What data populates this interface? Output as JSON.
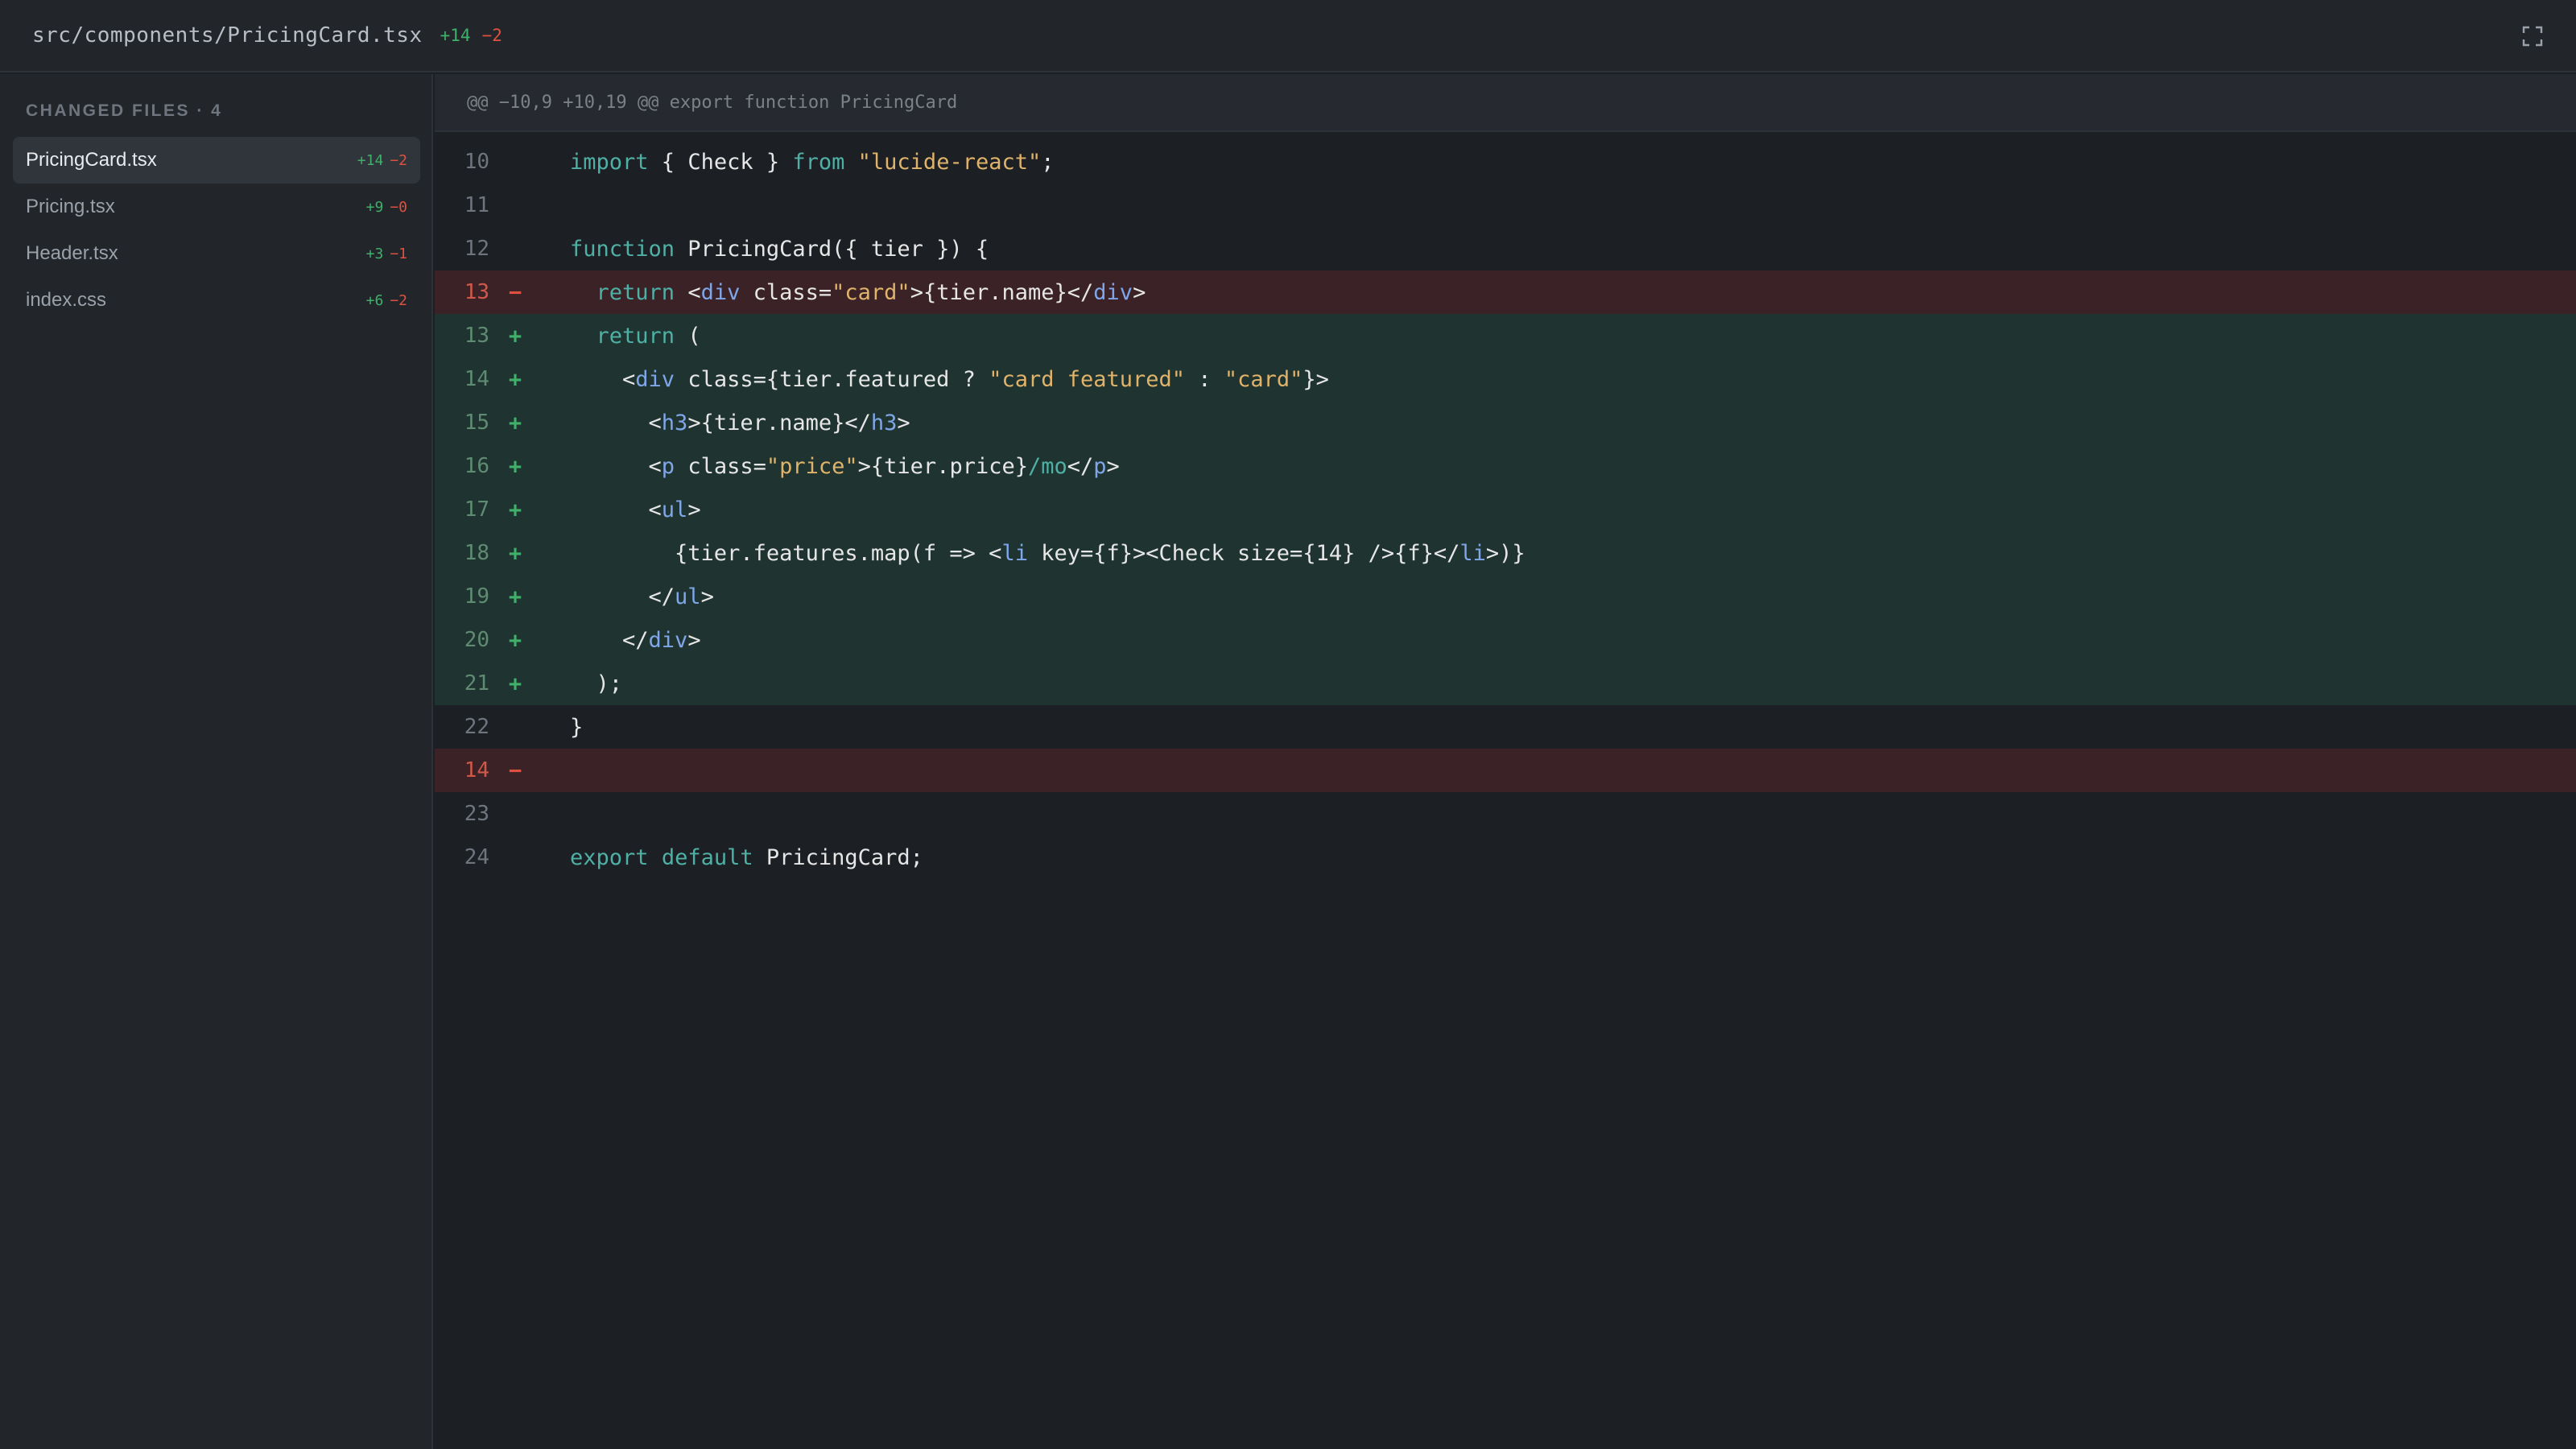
{
  "header": {
    "file_path": "src/components/PricingCard.tsx",
    "additions": "+14",
    "deletions": "−2",
    "expand_icon": "expand-icon"
  },
  "sidebar": {
    "title": "CHANGED FILES · 4",
    "files": [
      {
        "name": "PricingCard.tsx",
        "additions": "+14",
        "deletions": "−2",
        "active": true
      },
      {
        "name": "Pricing.tsx",
        "additions": "+9",
        "deletions": "−0",
        "active": false
      },
      {
        "name": "Header.tsx",
        "additions": "+3",
        "deletions": "−1",
        "active": false
      },
      {
        "name": "index.css",
        "additions": "+6",
        "deletions": "−2",
        "active": false
      }
    ]
  },
  "diff": {
    "hunk_header": "@@ −10,9 +10,19 @@ export function PricingCard",
    "lines": [
      {
        "num": "10",
        "type": "context",
        "marker": "",
        "tokens": [
          {
            "t": "import",
            "c": "kw"
          },
          {
            "t": " { Check } ",
            "c": "txt"
          },
          {
            "t": "from",
            "c": "kw"
          },
          {
            "t": " ",
            "c": "txt"
          },
          {
            "t": "\"lucide-react\"",
            "c": "str"
          },
          {
            "t": ";",
            "c": "txt"
          }
        ]
      },
      {
        "num": "11",
        "type": "context",
        "marker": "",
        "tokens": []
      },
      {
        "num": "12",
        "type": "context",
        "marker": "",
        "tokens": [
          {
            "t": "function",
            "c": "kw"
          },
          {
            "t": " PricingCard({ tier }) {",
            "c": "txt"
          }
        ]
      },
      {
        "num": "13",
        "type": "removed",
        "marker": "−",
        "tokens": [
          {
            "t": "  ",
            "c": "txt"
          },
          {
            "t": "return",
            "c": "kw"
          },
          {
            "t": " <",
            "c": "txt"
          },
          {
            "t": "div",
            "c": "tag"
          },
          {
            "t": " class=",
            "c": "txt"
          },
          {
            "t": "\"card\"",
            "c": "str"
          },
          {
            "t": ">{tier.name}</",
            "c": "txt"
          },
          {
            "t": "div",
            "c": "tag"
          },
          {
            "t": ">",
            "c": "txt"
          }
        ]
      },
      {
        "num": "13",
        "type": "added",
        "marker": "+",
        "tokens": [
          {
            "t": "  ",
            "c": "txt"
          },
          {
            "t": "return",
            "c": "kw"
          },
          {
            "t": " (",
            "c": "txt"
          }
        ]
      },
      {
        "num": "14",
        "type": "added",
        "marker": "+",
        "tokens": [
          {
            "t": "    <",
            "c": "txt"
          },
          {
            "t": "div",
            "c": "tag"
          },
          {
            "t": " class={tier.featured ? ",
            "c": "txt"
          },
          {
            "t": "\"card featured\"",
            "c": "str"
          },
          {
            "t": " : ",
            "c": "txt"
          },
          {
            "t": "\"card\"",
            "c": "str"
          },
          {
            "t": "}>",
            "c": "txt"
          }
        ]
      },
      {
        "num": "15",
        "type": "added",
        "marker": "+",
        "tokens": [
          {
            "t": "      <",
            "c": "txt"
          },
          {
            "t": "h3",
            "c": "tag"
          },
          {
            "t": ">{tier.name}</",
            "c": "txt"
          },
          {
            "t": "h3",
            "c": "tag"
          },
          {
            "t": ">",
            "c": "txt"
          }
        ]
      },
      {
        "num": "16",
        "type": "added",
        "marker": "+",
        "tokens": [
          {
            "t": "      <",
            "c": "txt"
          },
          {
            "t": "p",
            "c": "tag"
          },
          {
            "t": " class=",
            "c": "txt"
          },
          {
            "t": "\"price\"",
            "c": "str"
          },
          {
            "t": ">{tier.price}",
            "c": "txt"
          },
          {
            "t": "/mo",
            "c": "kw"
          },
          {
            "t": "</",
            "c": "txt"
          },
          {
            "t": "p",
            "c": "tag"
          },
          {
            "t": ">",
            "c": "txt"
          }
        ]
      },
      {
        "num": "17",
        "type": "added",
        "marker": "+",
        "tokens": [
          {
            "t": "      <",
            "c": "txt"
          },
          {
            "t": "ul",
            "c": "tag"
          },
          {
            "t": ">",
            "c": "txt"
          }
        ]
      },
      {
        "num": "18",
        "type": "added",
        "marker": "+",
        "tokens": [
          {
            "t": "        {tier.features.map(f => <",
            "c": "txt"
          },
          {
            "t": "li",
            "c": "tag"
          },
          {
            "t": " key={f}><Check size={14} />{f}</",
            "c": "txt"
          },
          {
            "t": "li",
            "c": "tag"
          },
          {
            "t": ">)}",
            "c": "txt"
          }
        ]
      },
      {
        "num": "19",
        "type": "added",
        "marker": "+",
        "tokens": [
          {
            "t": "      </",
            "c": "txt"
          },
          {
            "t": "ul",
            "c": "tag"
          },
          {
            "t": ">",
            "c": "txt"
          }
        ]
      },
      {
        "num": "20",
        "type": "added",
        "marker": "+",
        "tokens": [
          {
            "t": "    </",
            "c": "txt"
          },
          {
            "t": "div",
            "c": "tag"
          },
          {
            "t": ">",
            "c": "txt"
          }
        ]
      },
      {
        "num": "21",
        "type": "added",
        "marker": "+",
        "tokens": [
          {
            "t": "  );",
            "c": "txt"
          }
        ]
      },
      {
        "num": "22",
        "type": "context",
        "marker": "",
        "tokens": [
          {
            "t": "}",
            "c": "txt"
          }
        ]
      },
      {
        "num": "14",
        "type": "removed",
        "marker": "−",
        "tokens": []
      },
      {
        "num": "23",
        "type": "context",
        "marker": "",
        "tokens": []
      },
      {
        "num": "24",
        "type": "context",
        "marker": "",
        "tokens": [
          {
            "t": "export",
            "c": "kw"
          },
          {
            "t": " ",
            "c": "txt"
          },
          {
            "t": "default",
            "c": "kw"
          },
          {
            "t": " PricingCard;",
            "c": "txt"
          }
        ]
      }
    ]
  }
}
